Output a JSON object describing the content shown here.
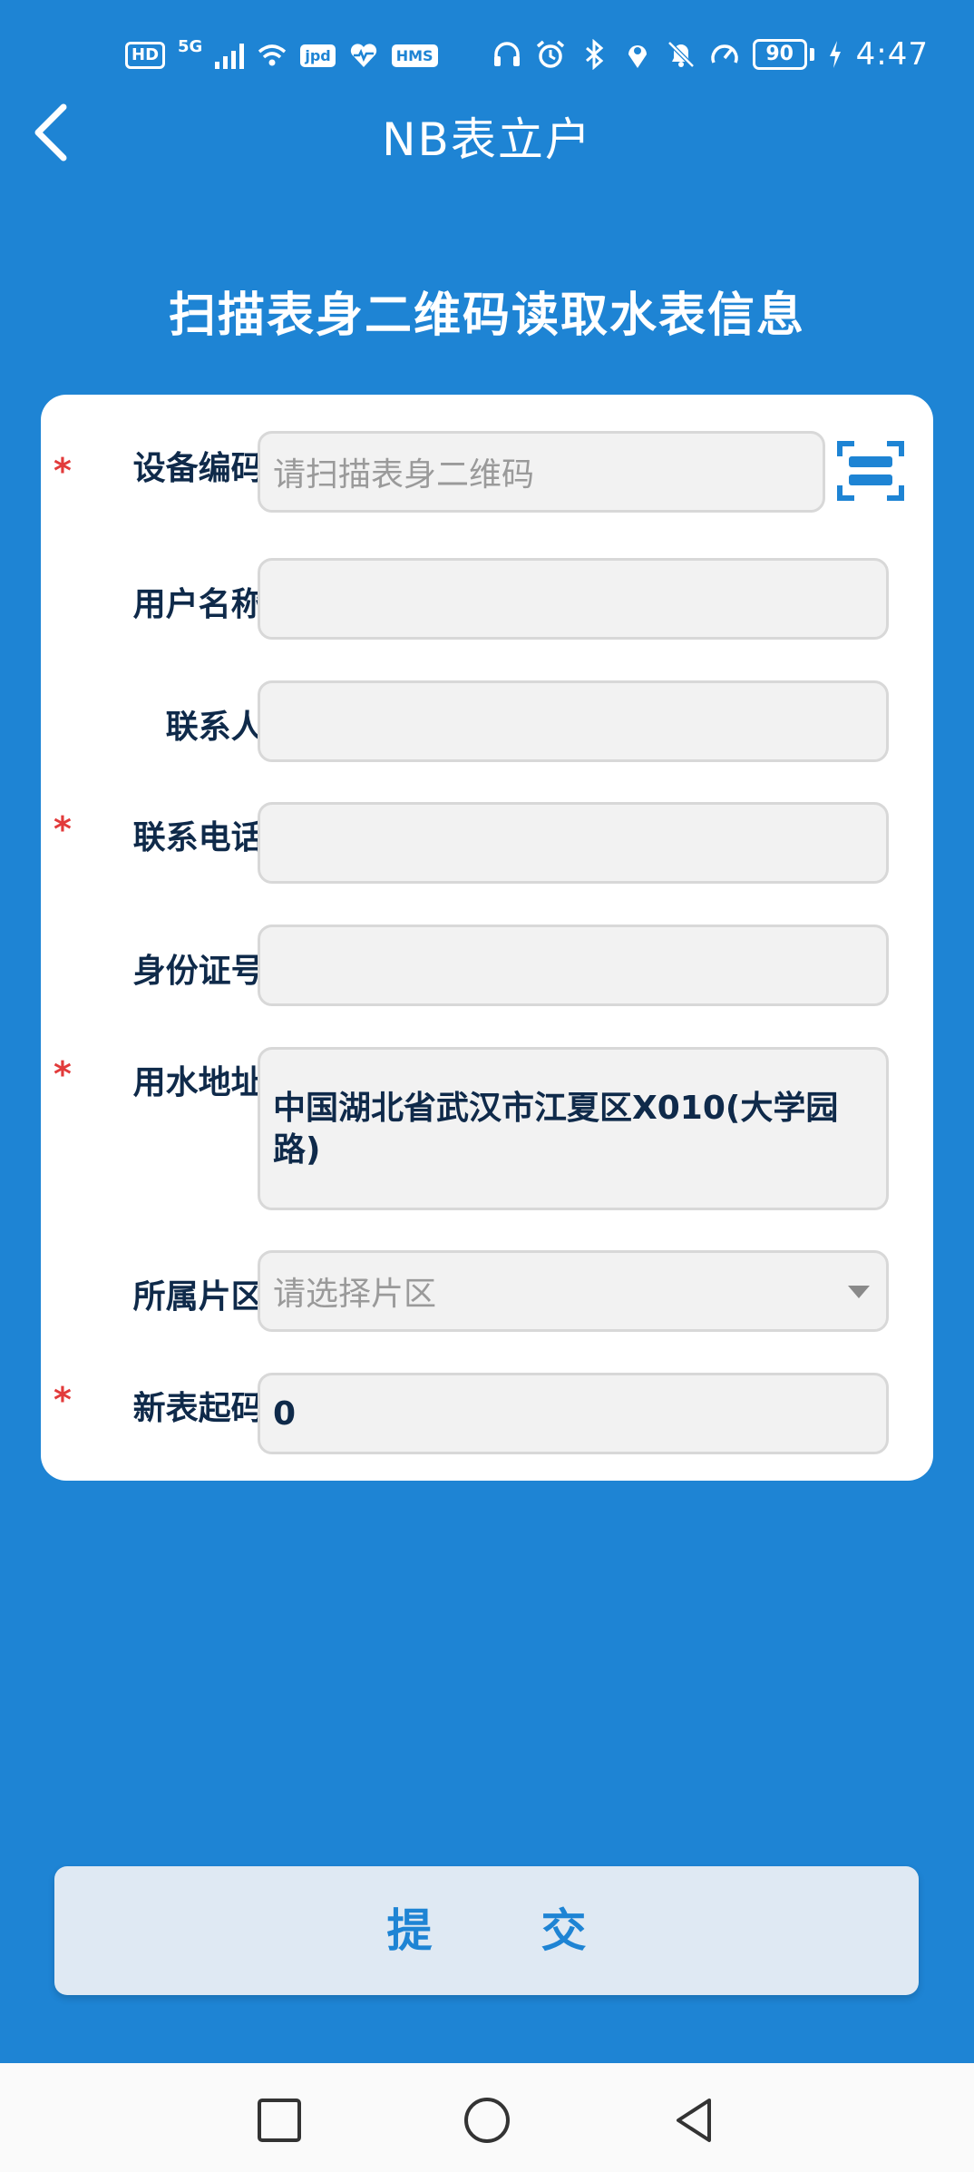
{
  "status_bar": {
    "hd_badge": "HD",
    "network": "5G",
    "hms_badge": "HMS",
    "battery": "90",
    "time": "4:47"
  },
  "header": {
    "title": "NB表立户"
  },
  "section_heading": "扫描表身二维码读取水表信息",
  "form": {
    "device_code": {
      "label": "设备编码:",
      "required": "*",
      "placeholder": "请扫描表身二维码",
      "value": ""
    },
    "user_name": {
      "label": "用户名称:",
      "value": ""
    },
    "contact": {
      "label": "联系人:",
      "value": ""
    },
    "phone": {
      "label": "联系电话:",
      "required": "*",
      "value": ""
    },
    "id_number": {
      "label": "身份证号:",
      "value": ""
    },
    "address": {
      "label": "用水地址:",
      "required": "*",
      "value": "中国湖北省武汉市江夏区X010(大学园路)"
    },
    "district": {
      "label": "所属片区:",
      "placeholder": "请选择片区"
    },
    "start_reading": {
      "label": "新表起码:",
      "required": "*",
      "value": "0"
    }
  },
  "submit_label": "提交",
  "colors": {
    "primary": "#1e84d4",
    "required": "#e23b3b",
    "label": "#0f2a4a"
  }
}
